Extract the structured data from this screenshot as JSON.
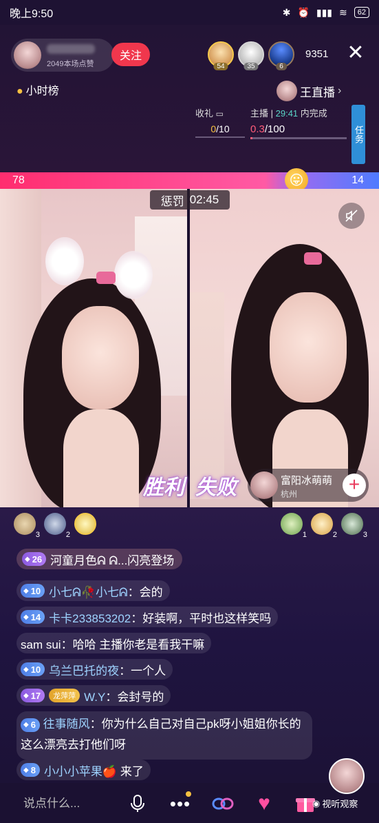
{
  "status": {
    "time": "晚上9:50",
    "battery": "62"
  },
  "header": {
    "host_likes": "2049本场点赞",
    "follow_label": "关注",
    "viewers": [
      {
        "badge": "54"
      },
      {
        "badge": "35"
      },
      {
        "badge": "6"
      }
    ],
    "viewer_count": "9351",
    "close_glyph": "✕",
    "hour_rank": "小时榜",
    "live_tag": "王直播"
  },
  "tasks": {
    "gift_label": "收礼",
    "gift_current": "0",
    "gift_total": "/10",
    "host_label": "主播",
    "host_timer": "29:41",
    "host_suffix": "内完成",
    "host_current": "0.3",
    "host_total": "/100",
    "host_progress": 0.003,
    "side_label": "任务"
  },
  "pk": {
    "left_score": "78",
    "right_score": "14",
    "emoji": "😛",
    "punish_label": "惩罚",
    "punish_time": "02:45",
    "win_label": "胜利",
    "lose_label": "失败",
    "opponent_name": "富阳冰萌萌",
    "opponent_city": "杭州"
  },
  "contributors_left": [
    {
      "rank": "3"
    },
    {
      "rank": "2"
    },
    {
      "rank": ""
    }
  ],
  "contributors_right": [
    {
      "rank": "1"
    },
    {
      "rank": "2"
    },
    {
      "rank": "3"
    }
  ],
  "chat": {
    "enter": {
      "level": "26",
      "text": "河童月色ᕱ ᕱ...闪亮登场"
    },
    "messages": [
      {
        "level": "10",
        "user": "小七ᕱ🥀小七ᕱ",
        "sep": "：",
        "text": "会的"
      },
      {
        "level": "14",
        "user": "卡卡233853202",
        "sep": "：",
        "text": "好装啊，平时也这样笑吗"
      },
      {
        "user": "sam sui",
        "sep": "：",
        "text": "哈哈 主播你老是看我干嘛"
      },
      {
        "level": "10",
        "user": "乌兰巴托的夜",
        "sep": "：",
        "text": "一个人"
      },
      {
        "level": "17",
        "tag": "龙萍萍",
        "user": "W.Y",
        "sep": "：",
        "text": "会封号的"
      },
      {
        "level": "6",
        "user": "往事随风",
        "sep": "：",
        "text": "你为什么自己对自己pk呀小姐姐你长的这么漂亮去打他们呀"
      },
      {
        "level": "8",
        "user": "小小小苹果🍎",
        "sep": " ",
        "text": "来了"
      }
    ]
  },
  "bottom": {
    "placeholder": "说点什么...",
    "watermark": "视听观察"
  },
  "colors": {
    "follow": "#f0374d",
    "pk_left": "#ff2d6f",
    "pk_right": "#4f7bff",
    "username": "#9ed3ff"
  }
}
